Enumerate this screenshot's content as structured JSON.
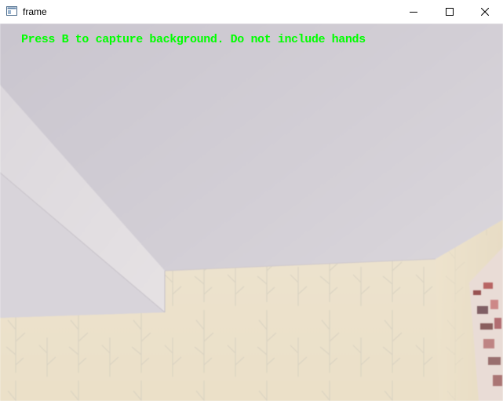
{
  "window": {
    "title": "frame"
  },
  "titlebar": {
    "icons": {
      "app": "app-window-icon",
      "minimize": "minimize-icon",
      "maximize": "maximize-icon",
      "close": "close-icon"
    }
  },
  "frame": {
    "overlay_text": "Press B to capture background. Do not include hands",
    "overlay_color": "#00ff00",
    "scene_description_colors": {
      "ceiling": "#d0ccd3",
      "wall": "#ede2cc",
      "side_wall": "#d9d5da"
    }
  }
}
